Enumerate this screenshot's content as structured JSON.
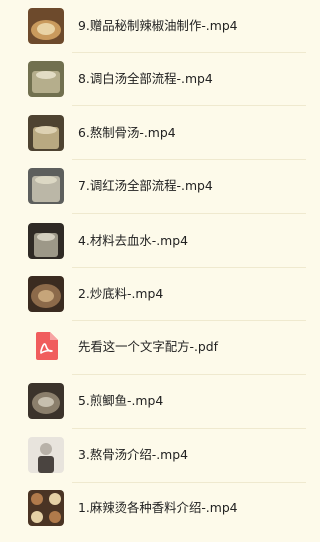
{
  "files": [
    {
      "label": "9.赠品秘制辣椒油制作-.mp4",
      "type": "video",
      "icon": "video-thumbnail",
      "colors": [
        "#6d4a2c",
        "#c99a5d",
        "#e9d3a5"
      ]
    },
    {
      "label": "8.调白汤全部流程-.mp4",
      "type": "video",
      "icon": "video-thumbnail",
      "colors": [
        "#71704f",
        "#b5ae8c",
        "#e2dcc4"
      ]
    },
    {
      "label": "6.熬制骨汤-.mp4",
      "type": "video",
      "icon": "video-thumbnail",
      "colors": [
        "#4e4331",
        "#b9a981",
        "#ddd1b2"
      ]
    },
    {
      "label": "7.调红汤全部流程-.mp4",
      "type": "video",
      "icon": "video-thumbnail",
      "colors": [
        "#5d5f5d",
        "#bbb7a7",
        "#dcd8c4"
      ]
    },
    {
      "label": "4.材料去血水-.mp4",
      "type": "video",
      "icon": "video-thumbnail",
      "colors": [
        "#2f2a25",
        "#9d9888",
        "#d4cfbf"
      ]
    },
    {
      "label": "2.炒底料-.mp4",
      "type": "video",
      "icon": "video-thumbnail",
      "colors": [
        "#3a2b20",
        "#8c6a4a",
        "#c6a57a"
      ]
    },
    {
      "label": "先看这一个文字配方-.pdf",
      "type": "pdf",
      "icon": "pdf-icon",
      "colors": [
        "#f05d5d",
        "#ffffff",
        "#f05d5d"
      ]
    },
    {
      "label": "5.煎鲫鱼-.mp4",
      "type": "video",
      "icon": "video-thumbnail",
      "colors": [
        "#3b332b",
        "#8b7f6c",
        "#c7bfae"
      ]
    },
    {
      "label": "3.熬骨汤介绍-.mp4",
      "type": "video",
      "icon": "video-thumbnail",
      "colors": [
        "#4a4440",
        "#b8b2a9",
        "#e8e4dd"
      ]
    },
    {
      "label": "1.麻辣烫各种香料介绍-.mp4",
      "type": "video",
      "icon": "video-thumbnail",
      "colors": [
        "#4a3424",
        "#b07a4b",
        "#e5d1a6"
      ]
    }
  ]
}
